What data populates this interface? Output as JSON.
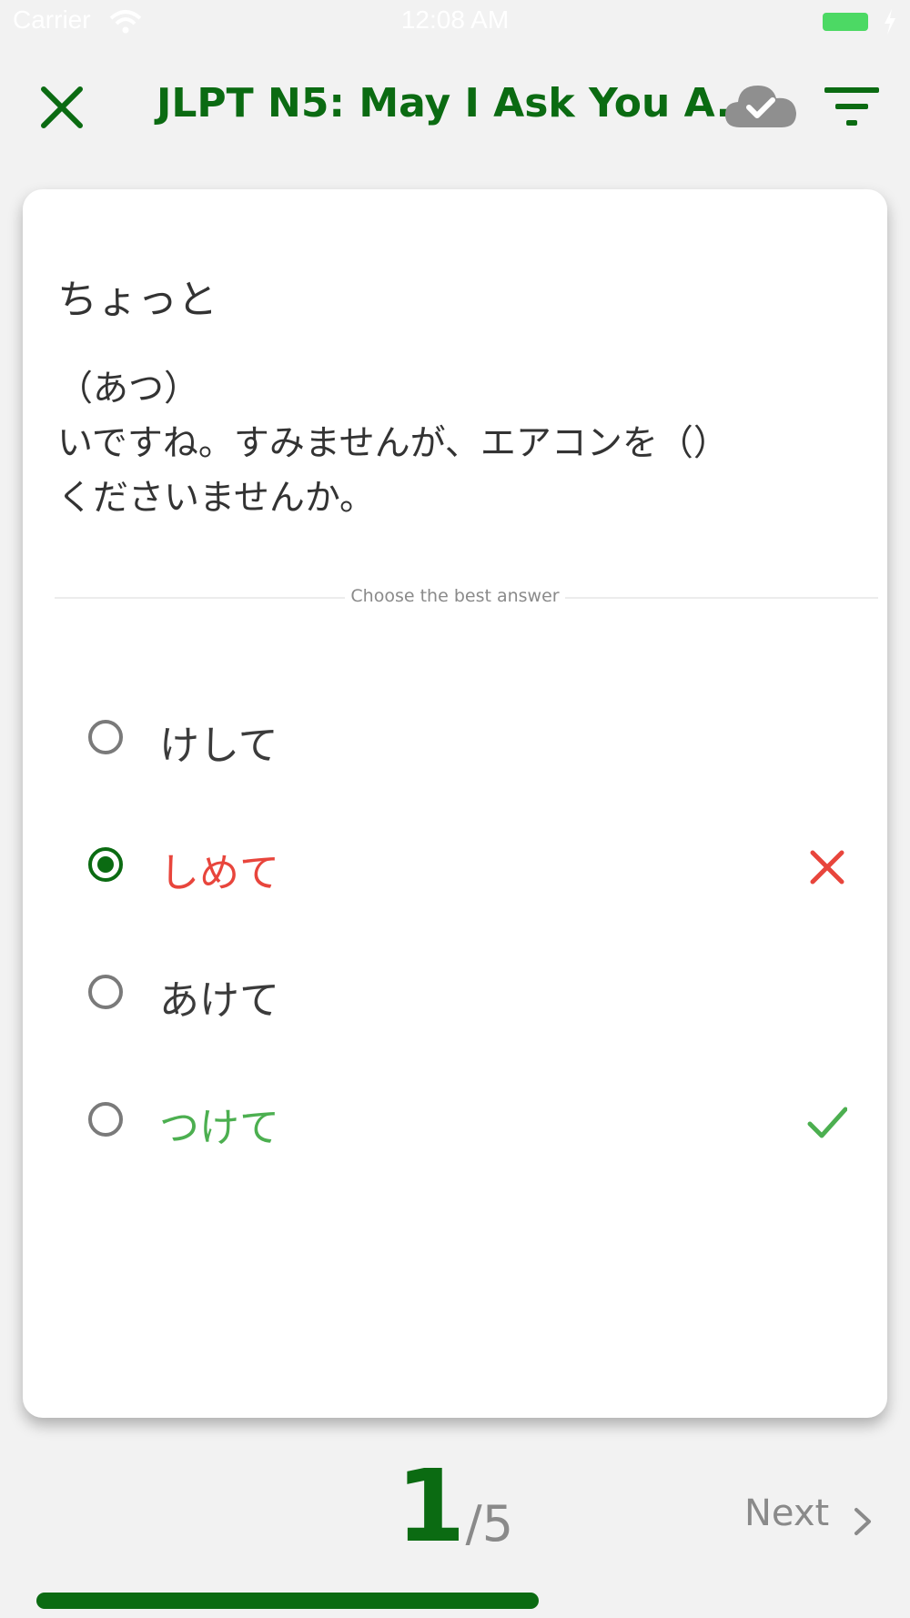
{
  "status_bar": {
    "carrier": "Carrier",
    "time": "12:08 AM",
    "battery_color": "#4cd964"
  },
  "nav": {
    "title": "JLPT N5: May I Ask You A...",
    "close_icon": "close-icon",
    "cloud_icon": "cloud-check-icon",
    "filter_icon": "filter-icon",
    "accent_color": "#0b6b12"
  },
  "question": {
    "heading": "ちょっと",
    "lines": [
      "（あつ）",
      "いですね。すみませんが、エアコンを（）",
      "くださいませんか。"
    ]
  },
  "instruction": "Choose the best answer",
  "options": [
    {
      "label": "けして",
      "state": "neutral",
      "selected": false
    },
    {
      "label": "しめて",
      "state": "wrong",
      "selected": true
    },
    {
      "label": "あけて",
      "state": "neutral",
      "selected": false
    },
    {
      "label": "つけて",
      "state": "correct",
      "selected": false
    }
  ],
  "colors": {
    "wrong": "#e8453c",
    "correct": "#4caf50"
  },
  "footer": {
    "current": "1",
    "total": "/5",
    "next_label": "Next",
    "progress_fraction": 0.6
  }
}
